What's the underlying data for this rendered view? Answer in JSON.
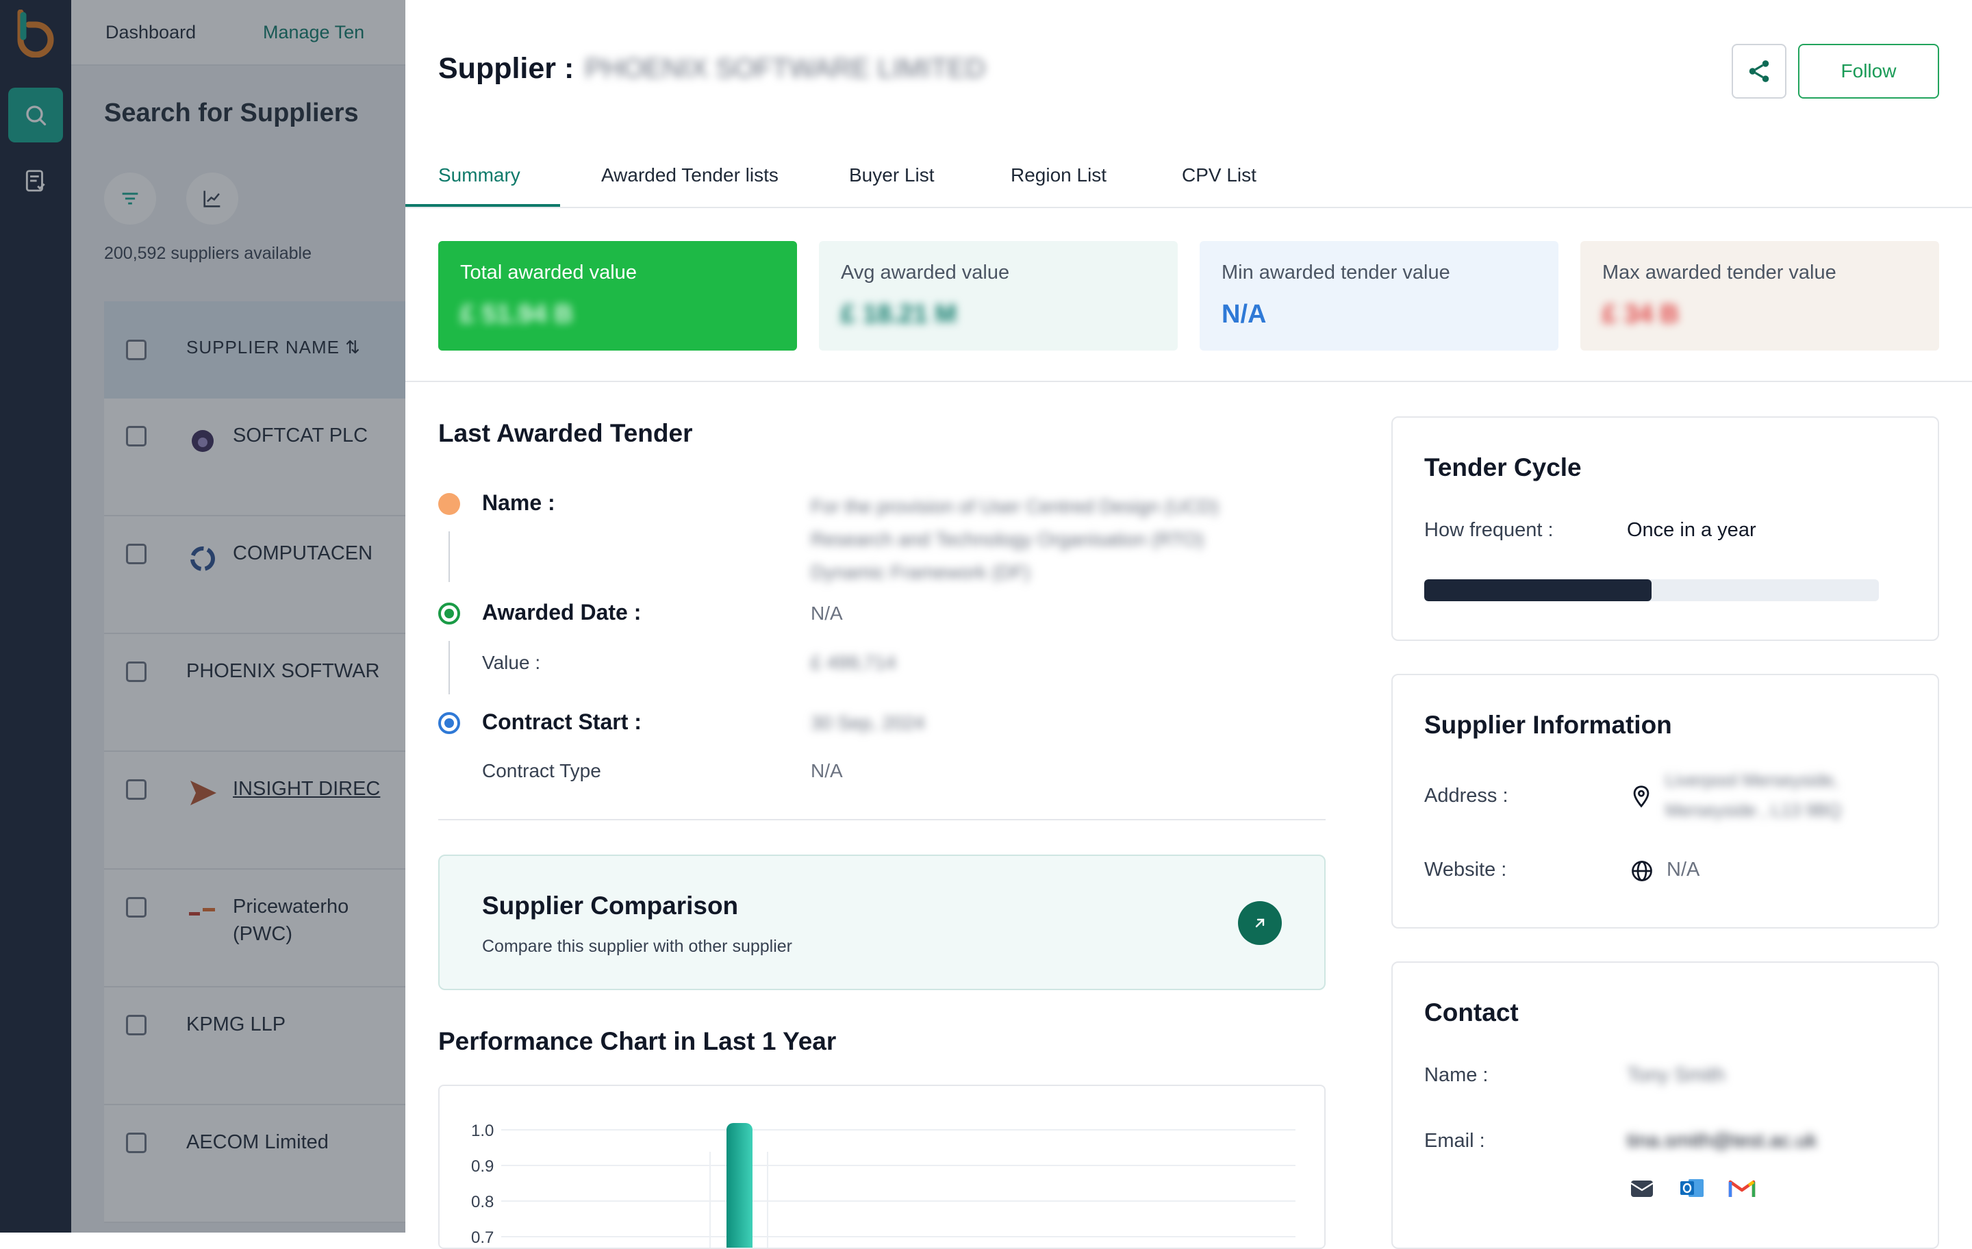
{
  "nav": {
    "dashboard": "Dashboard",
    "manage": "Manage Ten"
  },
  "background": {
    "search_title": "Search for Suppliers",
    "count": "200,592 suppliers available",
    "col_header": "SUPPLIER NAME",
    "rows": [
      {
        "name": "SOFTCAT PLC"
      },
      {
        "name": "COMPUTACEN"
      },
      {
        "name": "PHOENIX SOFTWAR"
      },
      {
        "name": "INSIGHT DIREC"
      },
      {
        "name": "Pricewaterho",
        "name2": "(PWC)"
      },
      {
        "name": "KPMG LLP"
      },
      {
        "name": "AECOM Limited"
      }
    ]
  },
  "drawer": {
    "title": "Supplier :",
    "supplier_name": "PHOENIX SOFTWARE LIMITED",
    "follow": "Follow",
    "tabs": [
      "Summary",
      "Awarded Tender lists",
      "Buyer List",
      "Region List",
      "CPV List"
    ],
    "stats": [
      {
        "label": "Total awarded value",
        "value": "£ 51.94 B"
      },
      {
        "label": "Avg awarded value",
        "value": "£ 18.21 M"
      },
      {
        "label": "Min awarded tender value",
        "value": "N/A"
      },
      {
        "label": "Max awarded tender value",
        "value": "£ 34 B"
      }
    ],
    "last_awarded": {
      "title": "Last Awarded Tender",
      "name_label": "Name :",
      "name_value": "For the provision of User Centred Design (UCD) Research and Technology Organisation (RTO) Dynamic Framework (DF)",
      "awarded_date_label": "Awarded Date :",
      "awarded_date_value": "N/A",
      "value_label": "Value :",
      "value_value": "£ 499,714",
      "contract_start_label": "Contract Start :",
      "contract_start_value": "30 Sep, 2024",
      "contract_type_label": "Contract Type",
      "contract_type_value": "N/A"
    },
    "comparison": {
      "title": "Supplier Comparison",
      "subtitle": "Compare this supplier with other supplier"
    },
    "performance_title": "Performance Chart in Last 1 Year",
    "tender_cycle": {
      "title": "Tender Cycle",
      "label": "How frequent :",
      "value": "Once in a year",
      "progress": 0.5
    },
    "supplier_info": {
      "title": "Supplier Information",
      "address_label": "Address :",
      "address_line1": "Liverpool Merseyside,",
      "address_line2": "Merseyside , L13 9BQ",
      "website_label": "Website :",
      "website_value": "N/A"
    },
    "contact": {
      "title": "Contact",
      "name_label": "Name :",
      "name_value": "Tony Smith",
      "email_label": "Email :",
      "email_value": "tina.smith@test.ac.uk"
    }
  },
  "chart_data": {
    "type": "bar",
    "yticks": [
      "1.0",
      "0.9",
      "0.8",
      "0.7"
    ],
    "bars": [
      1.0
    ],
    "ylim": [
      0.7,
      1.0
    ]
  }
}
